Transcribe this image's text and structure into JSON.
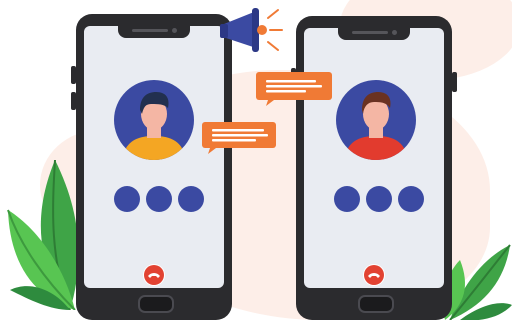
{
  "colors": {
    "phone_body": "#2b2b2e",
    "screen": "#e9ecf2",
    "avatar_bg": "#3b4aa2",
    "dot": "#3b4aa2",
    "bubble": "#f07a35",
    "end_call": "#e24232",
    "leaf_dark": "#2e8b3e",
    "leaf_light": "#58c552",
    "background_blob": "#fbe4dc",
    "megaphone": "#3b4aa2"
  },
  "left_phone": {
    "avatar": {
      "shirt_color": "#f4a623",
      "hair_color": "#22304f",
      "skin_color": "#f4b6a4"
    },
    "dots": 3,
    "end_call_icon": "phone-hangup-icon"
  },
  "right_phone": {
    "avatar": {
      "shirt_color": "#e23b2e",
      "hair_color": "#6a3222",
      "skin_color": "#f4b6a4"
    },
    "dots": 3,
    "end_call_icon": "phone-hangup-icon"
  },
  "decor": {
    "megaphone_icon": "megaphone-icon",
    "chat_bubbles": 2,
    "plants": 2
  }
}
